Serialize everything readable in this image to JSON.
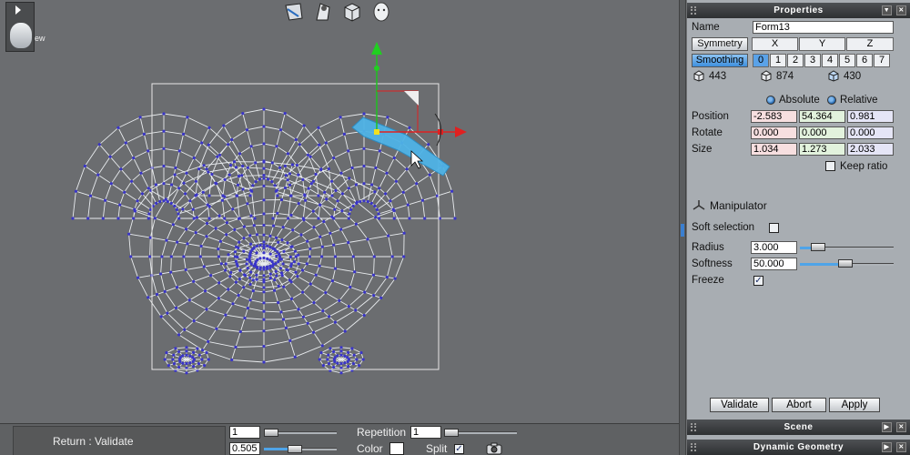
{
  "viewport": {
    "view_label": "ew"
  },
  "bottom_bar": {
    "return_label": "Return : Validate",
    "value1": "1",
    "value2": "0.505",
    "repetition_label": "Repetition",
    "repetition_value": "1",
    "color_label": "Color",
    "split_label": "Split",
    "split_checked": "✓"
  },
  "panel": {
    "title": "Properties",
    "name_label": "Name",
    "name_value": "Form13",
    "symmetry_label": "Symmetry",
    "axes": [
      "X",
      "Y",
      "Z"
    ],
    "smoothing_label": "Smoothing",
    "smoothing_levels": [
      "0",
      "1",
      "2",
      "3",
      "4",
      "5",
      "6",
      "7"
    ],
    "counts": [
      "443",
      "874",
      "430"
    ],
    "absolute_label": "Absolute",
    "relative_label": "Relative",
    "position_label": "Position",
    "position": [
      "-2.583",
      "54.364",
      "0.981"
    ],
    "rotate_label": "Rotate",
    "rotate": [
      "0.000",
      "0.000",
      "0.000"
    ],
    "size_label": "Size",
    "size": [
      "1.034",
      "1.273",
      "2.033"
    ],
    "keep_ratio_label": "Keep ratio",
    "manipulator_label": "Manipulator",
    "soft_selection_label": "Soft selection",
    "radius_label": "Radius",
    "radius_value": "3.000",
    "softness_label": "Softness",
    "softness_value": "50.000",
    "freeze_label": "Freeze",
    "freeze_checked": "✓",
    "validate_label": "Validate",
    "abort_label": "Abort",
    "apply_label": "Apply"
  },
  "scene_panel": {
    "title": "Scene"
  },
  "dynamic_panel": {
    "title": "Dynamic Geometry"
  },
  "colors": {
    "selection": "#4fb3e6",
    "vertex": "#3a35c8",
    "gizmo_x": "#e02020",
    "gizmo_y": "#20c020",
    "accent": "#4fa4e8"
  }
}
